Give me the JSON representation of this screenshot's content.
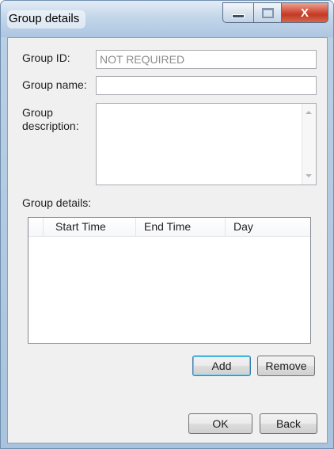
{
  "window": {
    "title": "Group details",
    "controls": {
      "minimize": "minimize",
      "maximize": "maximize",
      "close": "X"
    }
  },
  "form": {
    "group_id": {
      "label": "Group ID:",
      "value": "NOT REQUIRED"
    },
    "group_name": {
      "label": "Group name:",
      "value": ""
    },
    "group_description": {
      "label_line1": "Group",
      "label_line2": "description:",
      "value": ""
    }
  },
  "details": {
    "label": "Group details:",
    "columns": [
      "",
      "Start Time",
      "End Time",
      "Day"
    ],
    "rows": []
  },
  "buttons": {
    "add": "Add",
    "remove": "Remove",
    "ok": "OK",
    "back": "Back"
  },
  "icons": {
    "minimize": "minimize-icon",
    "maximize": "maximize-icon",
    "close": "close-icon",
    "scroll_up": "scroll-up-arrow-icon",
    "scroll_down": "scroll-down-arrow-icon"
  }
}
